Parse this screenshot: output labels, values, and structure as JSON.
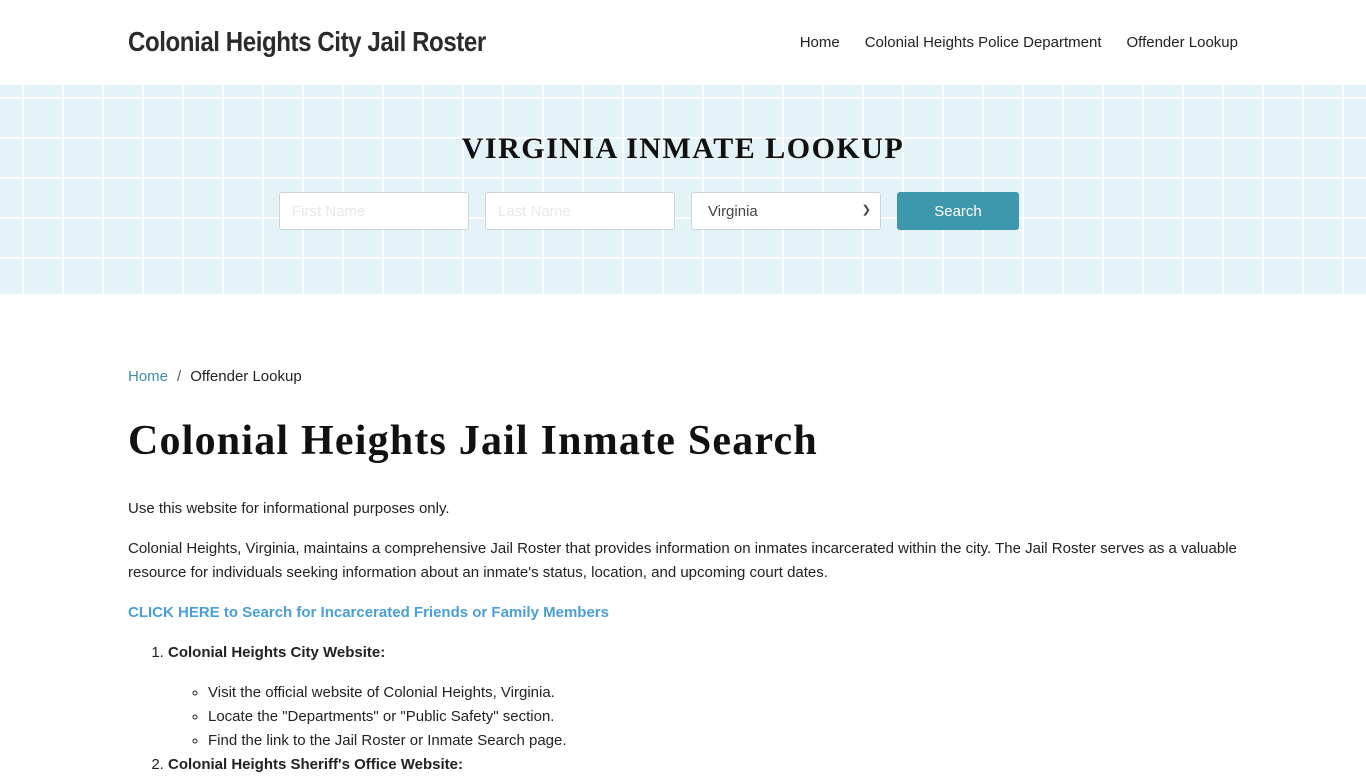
{
  "header": {
    "site_title": "Colonial Heights City Jail Roster",
    "nav": [
      {
        "label": "Home"
      },
      {
        "label": "Colonial Heights Police Department"
      },
      {
        "label": "Offender Lookup"
      }
    ]
  },
  "hero": {
    "title": "VIRGINIA INMATE LOOKUP",
    "first_name_placeholder": "First Name",
    "last_name_placeholder": "Last Name",
    "state_selected": "Virginia",
    "search_label": "Search",
    "accent_color": "#3d97ad"
  },
  "breadcrumb": {
    "home": "Home",
    "separator": "/",
    "current": "Offender Lookup"
  },
  "main": {
    "title": "Colonial Heights Jail Inmate Search",
    "intro": "Use this website for informational purposes only.",
    "description": "Colonial Heights, Virginia, maintains a comprehensive Jail Roster that provides information on inmates incarcerated within the city. The Jail Roster serves as a valuable resource for individuals seeking information about an inmate's status, location, and upcoming court dates.",
    "cta_link": "CLICK HERE to Search for Incarcerated Friends or Family Members",
    "steps": [
      {
        "title": "Colonial Heights City Website:",
        "items": [
          "Visit the official website of Colonial Heights, Virginia.",
          "Locate the \"Departments\" or \"Public Safety\" section.",
          "Find the link to the Jail Roster or Inmate Search page."
        ]
      },
      {
        "title": "Colonial Heights Sheriff's Office Website:"
      }
    ]
  }
}
